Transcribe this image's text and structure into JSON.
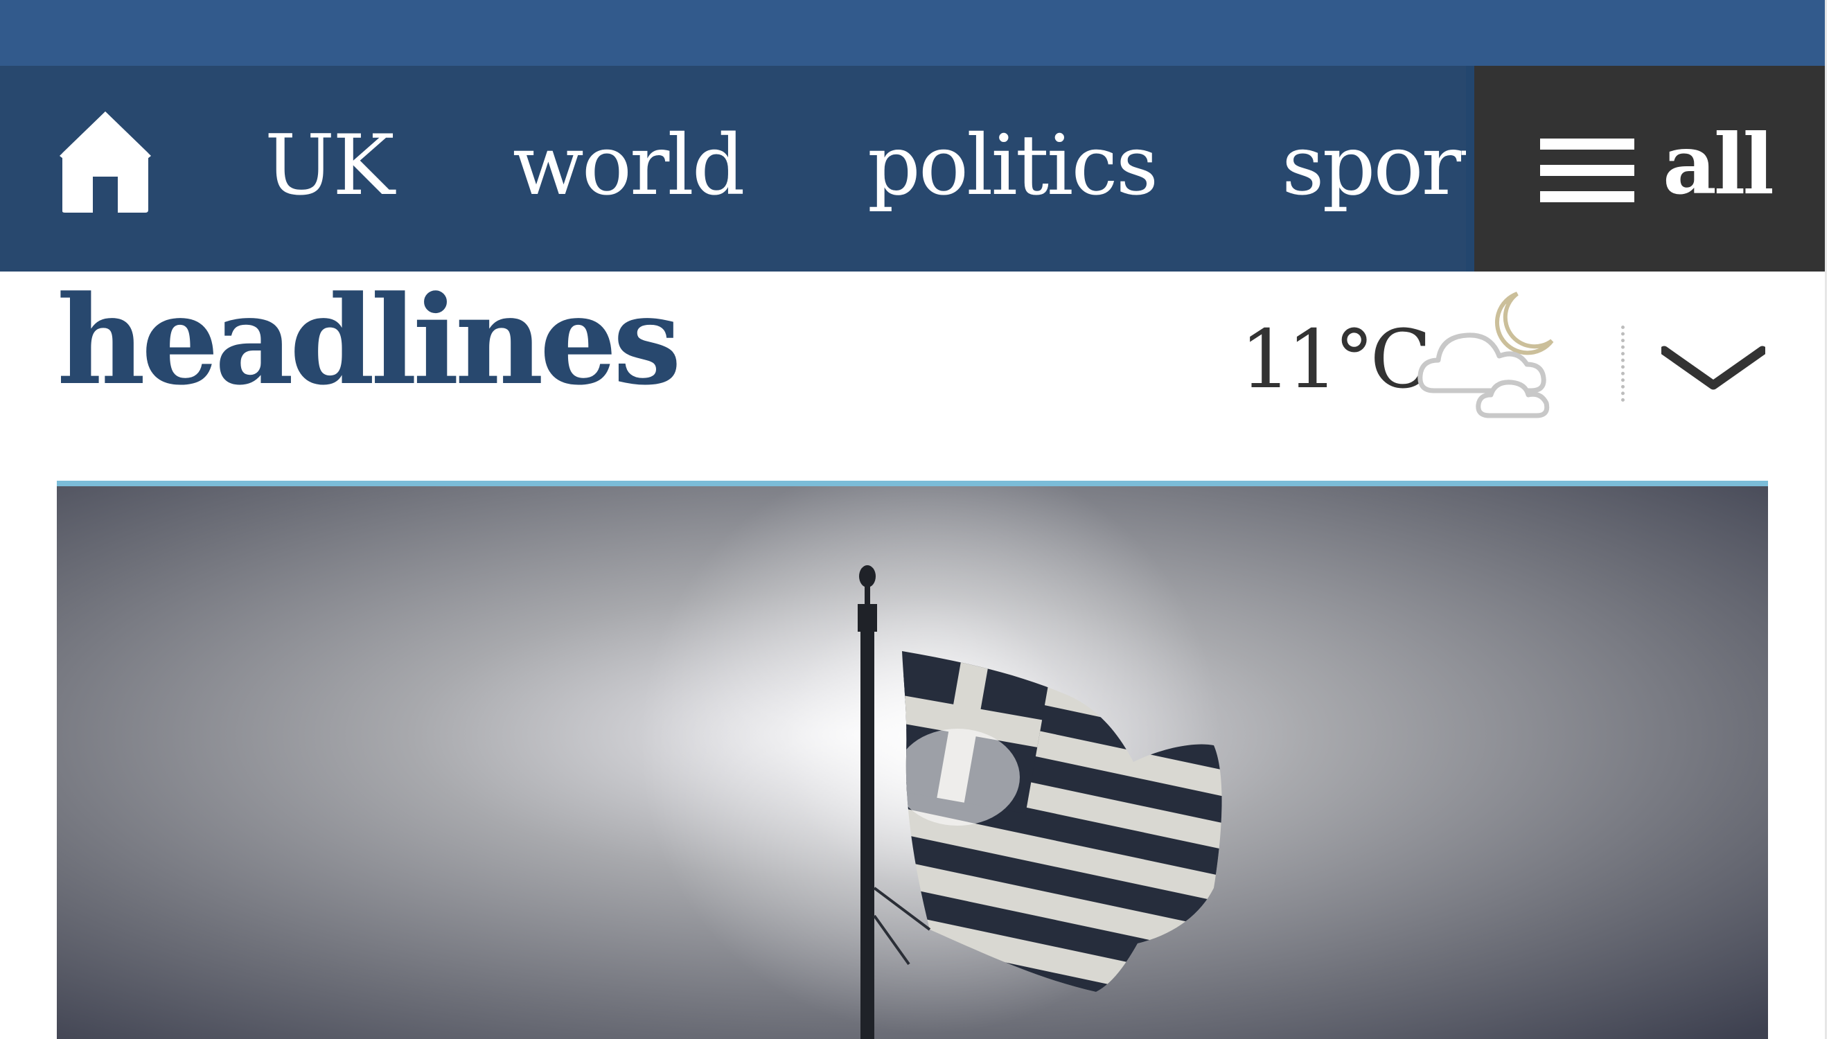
{
  "nav": {
    "home_icon": "home-icon",
    "items": [
      {
        "label": "UK"
      },
      {
        "label": "world"
      },
      {
        "label": "politics"
      },
      {
        "label": "sport"
      }
    ],
    "all_icon": "hamburger-menu-icon",
    "all_label": "all"
  },
  "header": {
    "title": "headlines"
  },
  "weather": {
    "temperature": "11°C",
    "icon": "cloudy-night-icon",
    "toggle_icon": "chevron-down-icon"
  },
  "colors": {
    "top_strip": "#325a8c",
    "navbar": "#28486e",
    "all_button": "#333333",
    "title": "#28486e",
    "section_rule": "#7bbcd8"
  },
  "hero": {
    "image": "greek-flag-photo"
  }
}
